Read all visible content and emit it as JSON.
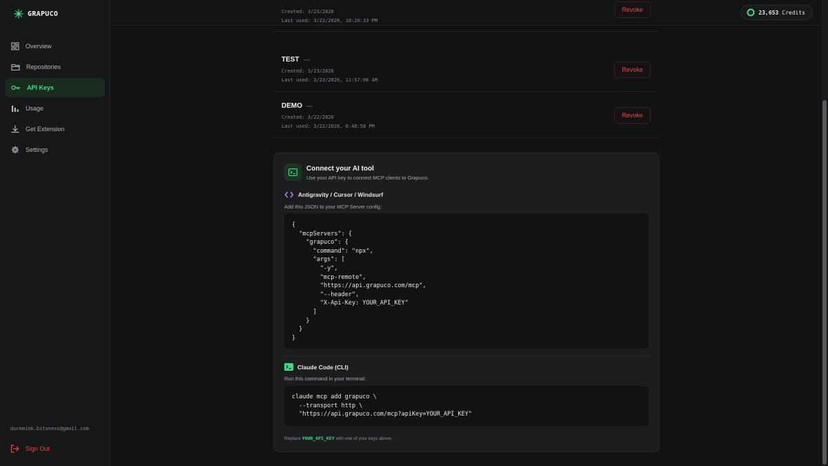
{
  "brand": {
    "name": "GRAPUCO",
    "accent": "#3ddc84"
  },
  "sidebar": {
    "items": [
      {
        "label": "Overview",
        "icon": "grid-icon"
      },
      {
        "label": "Repositories",
        "icon": "folder-icon"
      },
      {
        "label": "API Keys",
        "icon": "key-icon",
        "active": true
      },
      {
        "label": "Usage",
        "icon": "bar-chart-icon"
      },
      {
        "label": "Get Extension",
        "icon": "download-icon"
      },
      {
        "label": "Settings",
        "icon": "gear-icon"
      }
    ],
    "user_email": "duckmink.bitsness@gmail.com",
    "signout_label": "Sign Out"
  },
  "topbar": {
    "credits_value": "23,653",
    "credits_label": "Credits"
  },
  "keys": [
    {
      "name": "",
      "created": "Created: 3/23/2026",
      "last_used": "Last used: 3/22/2026, 10:20:33 PM",
      "revoke_label": "Revoke"
    },
    {
      "name": "TEST",
      "created": "Created: 3/23/2026",
      "last_used": "Last used: 3/23/2026, 11:57:06 AM",
      "revoke_label": "Revoke"
    },
    {
      "name": "DEMO",
      "created": "Created: 3/22/2026",
      "last_used": "Last used: 3/22/2026, 6:48:58 PM",
      "revoke_label": "Revoke"
    }
  ],
  "connect": {
    "title": "Connect your AI tool",
    "subtitle": "Use your API key to connect MCP clients to Grapuco.",
    "sections": [
      {
        "title": "Antigravity / Cursor / Windsurf",
        "icon": "code-brackets-icon",
        "desc": "Add this JSON to your MCP Server config:",
        "code": "{\n  \"mcpServers\": {\n    \"grapuco\": {\n      \"command\": \"npx\",\n      \"args\": [\n        \"-y\",\n        \"mcp-remote\",\n        \"https://api.grapuco.com/mcp\",\n        \"--header\",\n        \"X-Api-Key: YOUR_API_KEY\"\n      ]\n    }\n  }\n}"
      },
      {
        "title": "Claude Code (CLI)",
        "icon": "terminal-icon",
        "desc": "Run this command in your terminal:",
        "code": "claude mcp add grapuco \\\n  --transport http \\\n  \"https://api.grapuco.com/mcp?apiKey=YOUR_API_KEY\""
      }
    ],
    "note_prefix": "Replace",
    "note_key": "YOUR_API_KEY",
    "note_suffix": "with one of your keys above."
  }
}
